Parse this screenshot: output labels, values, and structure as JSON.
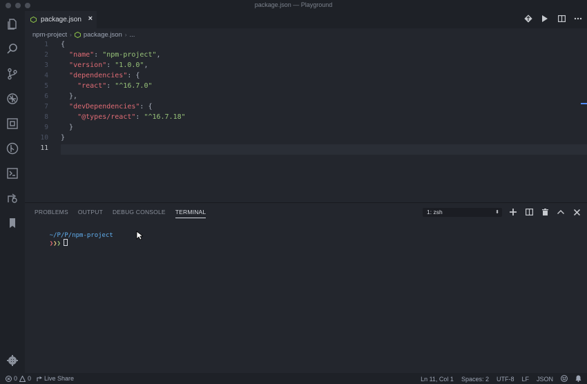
{
  "window": {
    "title": "package.json — Playground"
  },
  "tab": {
    "label": "package.json",
    "close": "×"
  },
  "tab_actions": [
    "git-compare-icon",
    "run-icon",
    "split-editor-icon",
    "more-actions-icon"
  ],
  "breadcrumb": {
    "folder": "npm-project",
    "file": "package.json",
    "more": "..."
  },
  "editor": {
    "line_numbers": [
      "1",
      "2",
      "3",
      "4",
      "5",
      "6",
      "7",
      "8",
      "9",
      "10",
      "11"
    ],
    "current_line": 11,
    "lines": [
      [
        {
          "t": "{",
          "c": "p"
        }
      ],
      [
        {
          "t": "  ",
          "c": "p"
        },
        {
          "t": "\"name\"",
          "c": "k"
        },
        {
          "t": ": ",
          "c": "p"
        },
        {
          "t": "\"npm-project\"",
          "c": "s"
        },
        {
          "t": ",",
          "c": "p"
        }
      ],
      [
        {
          "t": "  ",
          "c": "p"
        },
        {
          "t": "\"version\"",
          "c": "k"
        },
        {
          "t": ": ",
          "c": "p"
        },
        {
          "t": "\"1.0.0\"",
          "c": "s"
        },
        {
          "t": ",",
          "c": "p"
        }
      ],
      [
        {
          "t": "  ",
          "c": "p"
        },
        {
          "t": "\"dependencies\"",
          "c": "k"
        },
        {
          "t": ": {",
          "c": "p"
        }
      ],
      [
        {
          "t": "    ",
          "c": "p"
        },
        {
          "t": "\"react\"",
          "c": "k"
        },
        {
          "t": ": ",
          "c": "p"
        },
        {
          "t": "\"^16.7.0\"",
          "c": "s"
        }
      ],
      [
        {
          "t": "  },",
          "c": "p"
        }
      ],
      [
        {
          "t": "  ",
          "c": "p"
        },
        {
          "t": "\"devDependencies\"",
          "c": "k"
        },
        {
          "t": ": {",
          "c": "p"
        }
      ],
      [
        {
          "t": "    ",
          "c": "p"
        },
        {
          "t": "\"@types/react\"",
          "c": "k"
        },
        {
          "t": ": ",
          "c": "p"
        },
        {
          "t": "\"^16.7.18\"",
          "c": "s"
        }
      ],
      [
        {
          "t": "  }",
          "c": "p"
        }
      ],
      [
        {
          "t": "}",
          "c": "p"
        }
      ],
      [
        {
          "t": "",
          "c": "p"
        }
      ]
    ]
  },
  "panel": {
    "tabs": [
      "PROBLEMS",
      "OUTPUT",
      "DEBUG CONSOLE",
      "TERMINAL"
    ],
    "active_tab": "TERMINAL",
    "terminal_select": "1: zsh",
    "terminal_prompt": {
      "path": "~/P/P/npm-project",
      "arrows": [
        "❯",
        "❯",
        "❯"
      ]
    }
  },
  "status": {
    "errors": "0",
    "warnings": "0",
    "live_share": "Live Share",
    "position": "Ln 11, Col 1",
    "spaces": "Spaces: 2",
    "encoding": "UTF-8",
    "eol": "LF",
    "language": "JSON"
  },
  "colors": {
    "key": "#e06c75",
    "string": "#98c379",
    "accent": "#528bff",
    "background": "#23262d"
  }
}
